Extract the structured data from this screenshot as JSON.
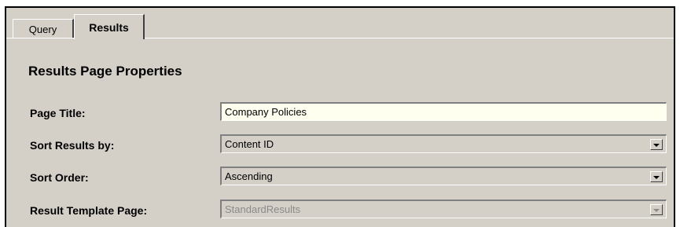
{
  "tabs": [
    {
      "label": "Query",
      "active": false
    },
    {
      "label": "Results",
      "active": true
    }
  ],
  "section": {
    "heading": "Results Page Properties"
  },
  "fields": {
    "page_title": {
      "label": "Page Title:",
      "value": "Company Policies"
    },
    "sort_results_by": {
      "label": "Sort Results by:",
      "value": "Content ID"
    },
    "sort_order": {
      "label": "Sort Order:",
      "value": "Ascending"
    },
    "result_template_page": {
      "label": "Result Template Page:",
      "value": "StandardResults",
      "disabled": true
    }
  },
  "icons": {
    "dropdown": "chevron-down-icon"
  },
  "colors": {
    "panel": "#d4d0c8",
    "input_bg": "#fffff0",
    "disabled_text": "#8a8a8a"
  }
}
